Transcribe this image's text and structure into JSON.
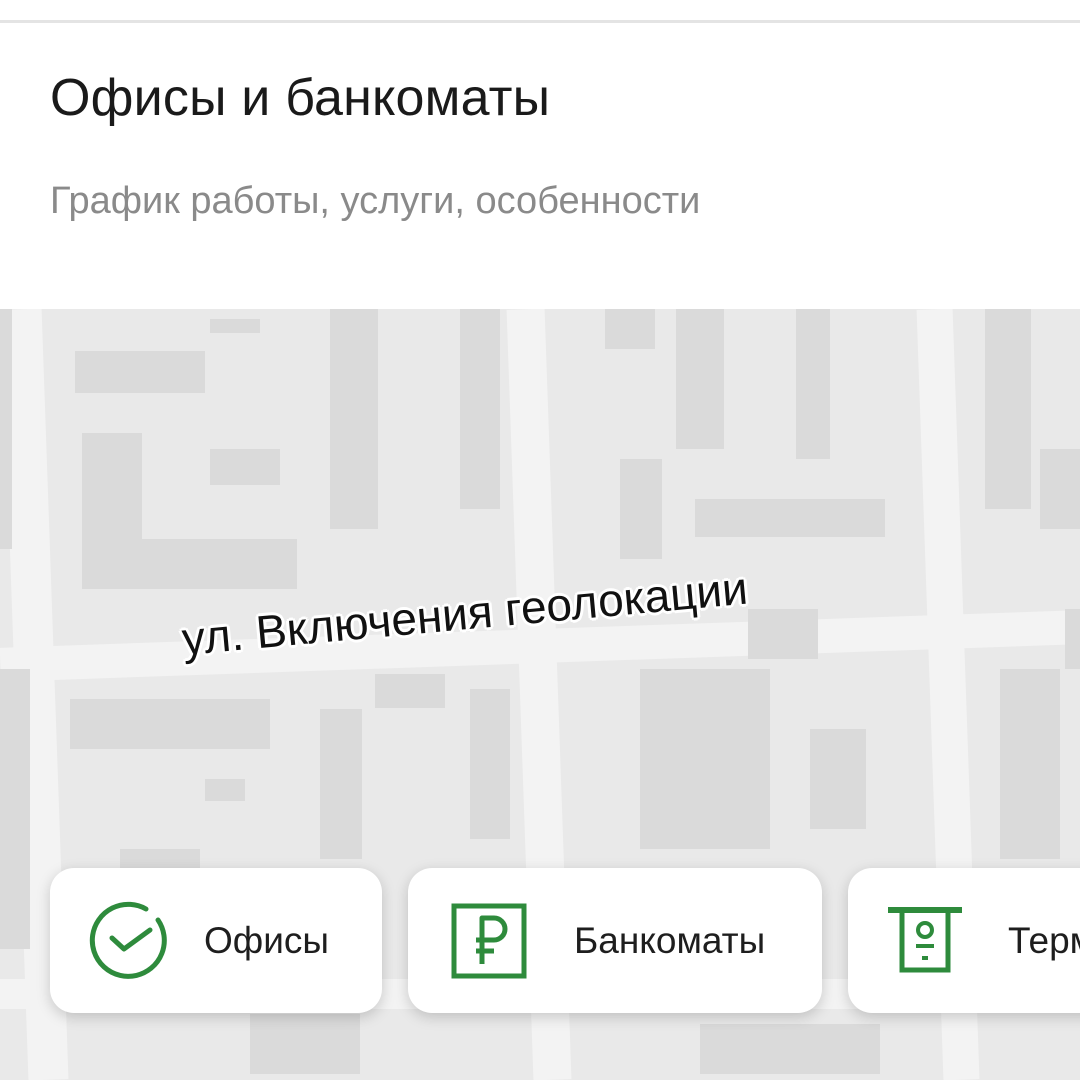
{
  "header": {
    "title": "Офисы и банкоматы",
    "subtitle": "График работы, услуги, особенности"
  },
  "map": {
    "street_label": "ул. Включения геолокации"
  },
  "filters": [
    {
      "label": "Офисы",
      "icon": "check-circle-icon"
    },
    {
      "label": "Банкоматы",
      "icon": "ruble-atm-icon"
    },
    {
      "label": "Терм",
      "icon": "terminal-icon"
    }
  ],
  "colors": {
    "accent": "#2e8b3c",
    "map_background": "#e9e9e9",
    "map_road": "#f4f4f4",
    "map_building": "#dadada"
  }
}
